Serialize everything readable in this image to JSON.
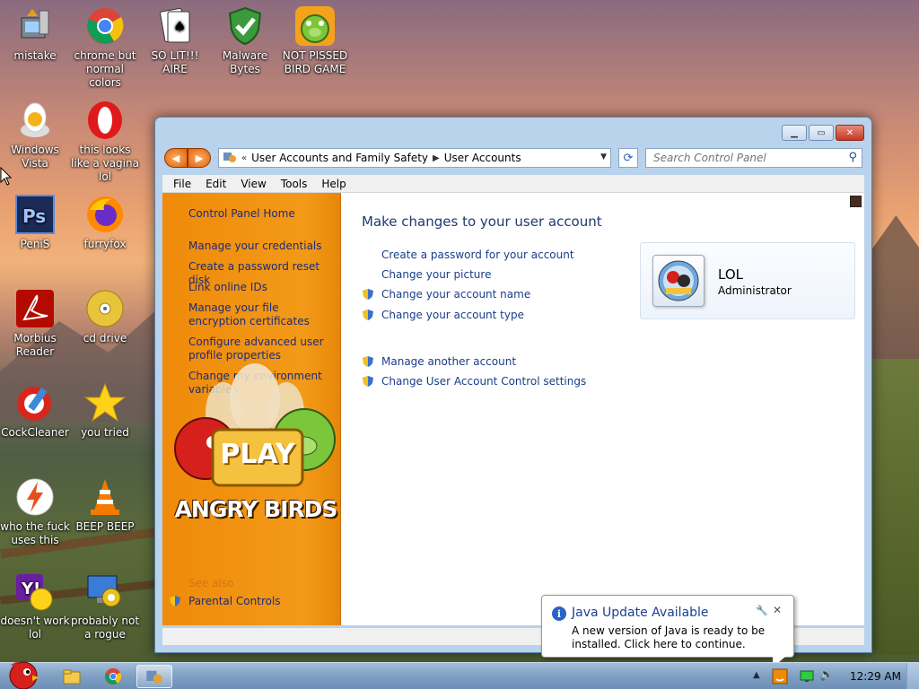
{
  "desktop": {
    "icons": [
      {
        "label": "mistake"
      },
      {
        "label": "chrome but normal colors"
      },
      {
        "label": "SO LIT!!! AIRE"
      },
      {
        "label": "Malware Bytes"
      },
      {
        "label": "NOT PISSED BIRD GAME"
      },
      {
        "label": "Windows Vista"
      },
      {
        "label": "this looks like a vagina lol"
      },
      {
        "label": "PeniS"
      },
      {
        "label": "furryfox"
      },
      {
        "label": "Morbius Reader"
      },
      {
        "label": "cd drive"
      },
      {
        "label": "CockCleaner"
      },
      {
        "label": "you tried"
      },
      {
        "label": "who the fuck uses this"
      },
      {
        "label": "BEEP BEEP"
      },
      {
        "label": "doesn't work lol"
      },
      {
        "label": "probably not a rogue"
      }
    ]
  },
  "window": {
    "address": {
      "crumbs": [
        "User Accounts and Family Safety",
        "User Accounts"
      ]
    },
    "search": {
      "placeholder": "Search Control Panel"
    },
    "menu": [
      "File",
      "Edit",
      "View",
      "Tools",
      "Help"
    ],
    "sidebar": {
      "home": "Control Panel Home",
      "links": [
        "Manage your credentials",
        "Create a password reset disk",
        "Link online IDs",
        "Manage your file encryption certificates",
        "Configure advanced user profile properties",
        "Change my environment variables"
      ],
      "see_also": "See also",
      "parental": "Parental Controls",
      "promo_play": "PLAY",
      "promo_title": "ANGRY BIRDS"
    },
    "main": {
      "heading": "Make changes to your user account",
      "tasks": [
        "Create a password for your account",
        "Change your picture",
        "Change your account name",
        "Change your account type"
      ],
      "tasks2": [
        "Manage another account",
        "Change User Account Control settings"
      ],
      "account": {
        "name": "LOL",
        "role": "Administrator"
      }
    }
  },
  "notification": {
    "title": "Java Update Available",
    "message": "A new version of Java is ready to be installed. Click here to continue."
  },
  "taskbar": {
    "clock": "12:29 AM"
  },
  "colors": {
    "accent_orange": "#f08a0a",
    "link_blue": "#1a3d8a"
  }
}
